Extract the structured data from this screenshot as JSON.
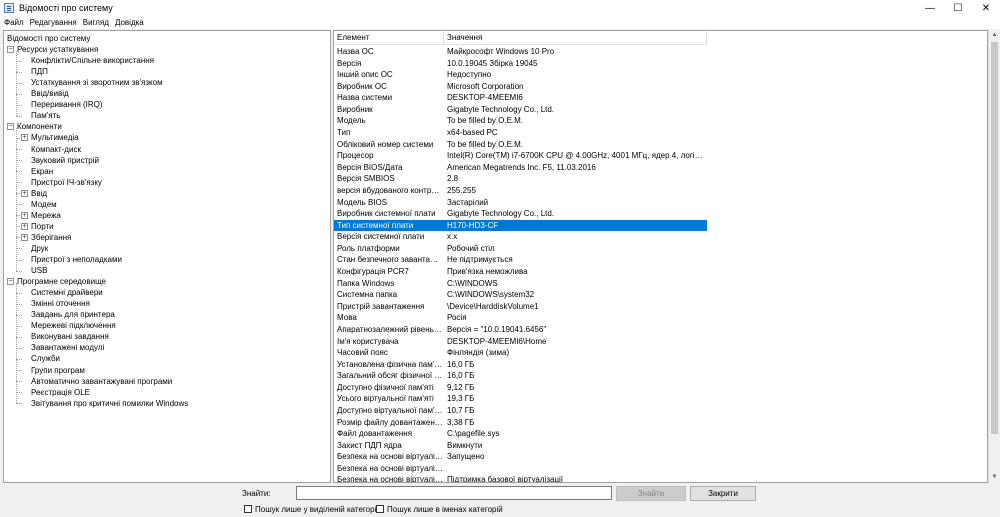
{
  "window": {
    "title": "Відомості про систему",
    "controls": {
      "minimize": "—",
      "maximize": "☐",
      "close": "✕"
    }
  },
  "menu": [
    "Файл",
    "Редагування",
    "Вигляд",
    "Довідка"
  ],
  "tree": {
    "root": "Відомості про систему",
    "groups": [
      {
        "label": "Ресурси устаткування",
        "children": [
          {
            "label": "Конфлікти/Спільне використання",
            "expandable": false
          },
          {
            "label": "ПДП",
            "expandable": false
          },
          {
            "label": "Устаткування зі зворотним зв'язком",
            "expandable": false
          },
          {
            "label": "Ввід/вивід",
            "expandable": false
          },
          {
            "label": "Переривання (IRQ)",
            "expandable": false
          },
          {
            "label": "Пам'ять",
            "expandable": false
          }
        ]
      },
      {
        "label": "Компоненти",
        "children": [
          {
            "label": "Мультимедіа",
            "expandable": true
          },
          {
            "label": "Компакт-диск",
            "expandable": false
          },
          {
            "label": "Звуковий пристрій",
            "expandable": false
          },
          {
            "label": "Екран",
            "expandable": false
          },
          {
            "label": "Пристрої ІЧ-зв'язку",
            "expandable": false
          },
          {
            "label": "Ввід",
            "expandable": true
          },
          {
            "label": "Модем",
            "expandable": false
          },
          {
            "label": "Мережа",
            "expandable": true
          },
          {
            "label": "Порти",
            "expandable": true
          },
          {
            "label": "Зберігання",
            "expandable": true
          },
          {
            "label": "Друк",
            "expandable": false
          },
          {
            "label": "Пристрої з неполадками",
            "expandable": false
          },
          {
            "label": "USB",
            "expandable": false
          }
        ]
      },
      {
        "label": "Програмне середовище",
        "children": [
          {
            "label": "Системні драйвери",
            "expandable": false
          },
          {
            "label": "Змінні оточення",
            "expandable": false
          },
          {
            "label": "Завдань для принтера",
            "expandable": false
          },
          {
            "label": "Мережеві підключення",
            "expandable": false
          },
          {
            "label": "Виконувані завдання",
            "expandable": false
          },
          {
            "label": "Завантажені модулі",
            "expandable": false
          },
          {
            "label": "Служби",
            "expandable": false
          },
          {
            "label": "Групи програм",
            "expandable": false
          },
          {
            "label": "Автоматично завантажувані програми",
            "expandable": false
          },
          {
            "label": "Реєстрація OLE",
            "expandable": false
          },
          {
            "label": "Звітування про критичні помилки Windows",
            "expandable": false
          }
        ]
      }
    ]
  },
  "details": {
    "columns": {
      "item": "Елемент",
      "value": "Значення"
    },
    "selected_index": 16,
    "rows": [
      {
        "item": "Назва ОС",
        "value": "Майкрософт Windows 10 Pro"
      },
      {
        "item": "Версія",
        "value": "10.0.19045 Збірка 19045"
      },
      {
        "item": "Інший опис ОС",
        "value": "Недоступно"
      },
      {
        "item": "Виробник ОС",
        "value": "Microsoft Corporation"
      },
      {
        "item": "Назва системи",
        "value": "DESKTOP-4MEEMI6"
      },
      {
        "item": "Виробник",
        "value": "Gigabyte Technology Co., Ltd."
      },
      {
        "item": "Модель",
        "value": "To be filled by O.E.M."
      },
      {
        "item": "Тип",
        "value": "x64-based PC"
      },
      {
        "item": "Обліковий номер системи",
        "value": "To be filled by O.E.M."
      },
      {
        "item": "Процесор",
        "value": "Intel(R) Core(TM) i7-6700K CPU @ 4.00GHz, 4001 МГц, ядер 4, логічних проц..."
      },
      {
        "item": "Версія BIOS/Дата",
        "value": "American Megatrends Inc. F5, 11.03.2016"
      },
      {
        "item": "Версія SMBIOS",
        "value": "2.8"
      },
      {
        "item": "версія вбудованого контроле...",
        "value": "255.255"
      },
      {
        "item": "Модель BIOS",
        "value": "Застарілий"
      },
      {
        "item": "Виробник системної плати",
        "value": "Gigabyte Technology Co., Ltd."
      },
      {
        "item": "Тип системної плати",
        "value": "H170-HD3-CF"
      },
      {
        "item": "Версія системної плати",
        "value": "x.x"
      },
      {
        "item": "Роль платформи",
        "value": "Робочий стіл"
      },
      {
        "item": "Стан безпечного завантаження",
        "value": "Не підтримується"
      },
      {
        "item": "Конфігурація PCR7",
        "value": "Прив'язка неможлива"
      },
      {
        "item": "Папка Windows",
        "value": "C:\\WINDOWS"
      },
      {
        "item": "Системна папка",
        "value": "C:\\WINDOWS\\system32"
      },
      {
        "item": "Пристрій завантаження",
        "value": "\\Device\\HarddiskVolume1"
      },
      {
        "item": "Мова",
        "value": "Росія"
      },
      {
        "item": "Апаратнозалежний рівень (HAL)",
        "value": "Версія = \"10.0.19041.6456\""
      },
      {
        "item": "Ім'я користувача",
        "value": "DESKTOP-4MEEMI6\\Home"
      },
      {
        "item": "Часовий пояс",
        "value": "Фінляндія (зима)"
      },
      {
        "item": "Установлена фізична пам'ять (...",
        "value": "16,0 ГБ"
      },
      {
        "item": "Загальний обсяг фізичної пам'...",
        "value": "16,0 ГБ"
      },
      {
        "item": "Доступно фізичної пам'яті",
        "value": "9,12 ГБ"
      },
      {
        "item": "Усього віртуальної пам'яті",
        "value": "19,3 ГБ"
      },
      {
        "item": "Доступно віртуальної пам'яті",
        "value": "10,7 ГБ"
      },
      {
        "item": "Розмір файлу довантаження",
        "value": "3,38 ГБ"
      },
      {
        "item": "Файл довантаження",
        "value": "C:\\pagefile.sys"
      },
      {
        "item": "Захист ПДП ядра",
        "value": "Вимкнути"
      },
      {
        "item": "Безпека на основі віртуалізаці...",
        "value": "Запущено"
      },
      {
        "item": "Безпека на основі віртуалізаці...",
        "value": ""
      },
      {
        "item": "Безпека на основі віртуалізаці...",
        "value": "Підтримка базової віртуалізації"
      }
    ]
  },
  "search": {
    "label": "Знайти:",
    "value": "",
    "find_button": "Знайти",
    "close_button": "Закрити",
    "check_selected": "Пошук лише у виділеній категорії",
    "check_names": "Пошук лише в іменах категорій"
  },
  "colors": {
    "selection": "#0078d7"
  }
}
